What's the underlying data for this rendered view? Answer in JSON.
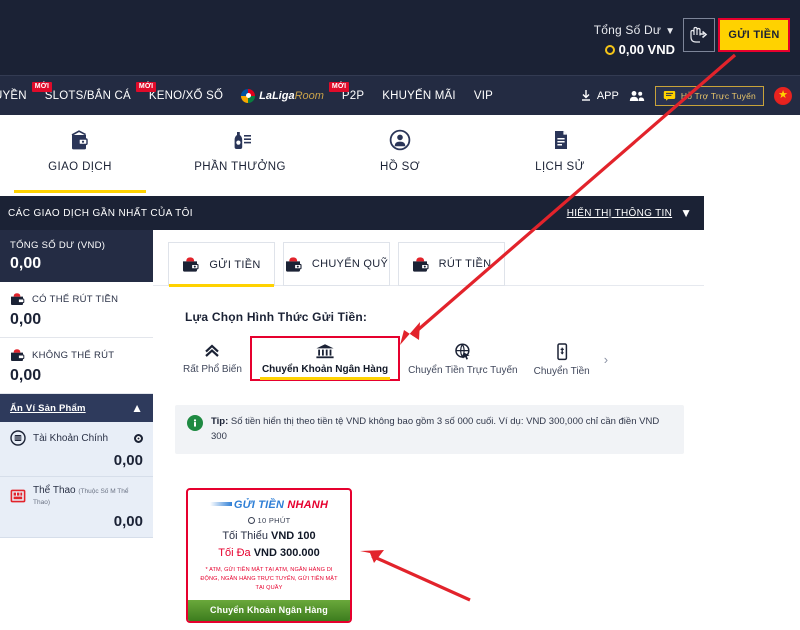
{
  "header": {
    "balance_label": "Tổng Số Dư",
    "balance_amount": "0,00 VND",
    "deposit_button": "GỬI TIỀN",
    "transfer_icon": "hand-transfer-icon",
    "chevron_icon": "chevron-down-icon"
  },
  "nav": {
    "items": [
      {
        "label": "UYỀN",
        "badge": "",
        "cut": true
      },
      {
        "label": "SLOTS/BẮN CÁ",
        "badge": "MỚI"
      },
      {
        "label": "KENO/XỔ SỐ",
        "badge": "MỚI"
      },
      {
        "label": "P2P",
        "badge": "MỚI"
      },
      {
        "label": "KHUYẾN MÃI",
        "badge": ""
      },
      {
        "label": "VIP",
        "badge": ""
      }
    ],
    "laliga": {
      "main": "LaLiga",
      "sub": "Room"
    },
    "app_label": "APP",
    "support_label": "Hỗ Trợ Trực Tuyến",
    "download_icon": "download-icon",
    "friends_icon": "people-icon",
    "support_icon": "chat-support-icon",
    "flag_icon": "vietnam-flag-icon"
  },
  "main_tabs": [
    {
      "label": "GIAO DỊCH",
      "icon": "wallet-icon",
      "active": true
    },
    {
      "label": "PHẦN THƯỞNG",
      "icon": "reward-icon",
      "active": false
    },
    {
      "label": "HỒ SƠ",
      "icon": "profile-icon",
      "active": false
    },
    {
      "label": "LỊCH SỬ",
      "icon": "history-document-icon",
      "active": false
    }
  ],
  "recent_bar": {
    "title": "CÁC GIAO DỊCH GẦN NHẤT CỦA TÔI",
    "toggle_label": "HIỂN THỊ THÔNG TIN",
    "toggle_icon": "chevron-down-icon"
  },
  "sidebar": {
    "total_label": "TỔNG SỐ DƯ",
    "total_currency": "(VND)",
    "total_value": "0,00",
    "rows": [
      {
        "label": "CÓ THỂ RÚT TIỀN",
        "value": "0,00",
        "icon": "wallet-red-icon"
      },
      {
        "label": "KHÔNG THỂ RÚT",
        "value": "0,00",
        "icon": "wallet-red-icon"
      }
    ],
    "section_label": "Ẩn Ví Sản Phẩm",
    "section_icon": "chevron-up-icon",
    "wallets": [
      {
        "name": "Tài Khoản Chính",
        "sub": "",
        "value": "0,00",
        "icon": "main-account-icon"
      },
      {
        "name": "Thể Thao",
        "sub": "(Thuộc Số M Thể Thao)",
        "value": "0,00",
        "icon": "sports-icon"
      }
    ]
  },
  "panel": {
    "tabs": [
      {
        "label": "GỬI TIỀN",
        "icon": "wallet-icon",
        "active": true
      },
      {
        "label": "CHUYỂN QUỸ",
        "icon": "wallet-icon",
        "active": false
      },
      {
        "label": "RÚT TIỀN",
        "icon": "wallet-icon",
        "active": false
      }
    ],
    "select_title": "Lựa Chọn Hình Thức Gửi Tiền:",
    "methods": [
      {
        "label": "Rất Phổ Biến",
        "icon": "double-chevron-up-icon",
        "selected": false
      },
      {
        "label": "Chuyển Khoản Ngân Hàng",
        "icon": "bank-icon",
        "selected": true
      },
      {
        "label": "Chuyển Tiền Trực Tuyến",
        "icon": "globe-cursor-icon",
        "selected": false
      },
      {
        "label": "Chuyển Tiền",
        "icon": "mobile-transfer-icon",
        "selected": false
      }
    ],
    "methods_next_icon": "chevron-right-icon",
    "tip": {
      "prefix": "Tip:",
      "text": "Số tiền hiển thị theo tiền tệ VND không bao gồm 3 số 000 cuối. Ví dụ: VND 300,000 chỉ cần điền VND 300",
      "icon": "info-icon"
    }
  },
  "promo": {
    "title_a": "GỬI TIỀN",
    "title_b": "NHANH",
    "time": "10 PHÚT",
    "time_icon": "clock-icon",
    "min_label": "Tối Thiểu",
    "min_value": "VND 100",
    "max_label": "Tối Đa",
    "max_value": "VND 300.000",
    "note": "* ATM, GỬI TIỀN MẶT TẠI ATM, NGÂN HÀNG DI ĐỘNG, NGÂN HÀNG TRỰC TUYẾN, GỬI TIỀN MẶT TẠI QUẦY",
    "footer": "Chuyển Khoản Ngân Hàng"
  },
  "colors": {
    "header_bg": "#1b2235",
    "nav_bg": "#232b42",
    "accent_yellow": "#ffd200",
    "accent_red": "#e6002e",
    "annotation_red": "#e2232b",
    "green": "#3d7d1e"
  }
}
